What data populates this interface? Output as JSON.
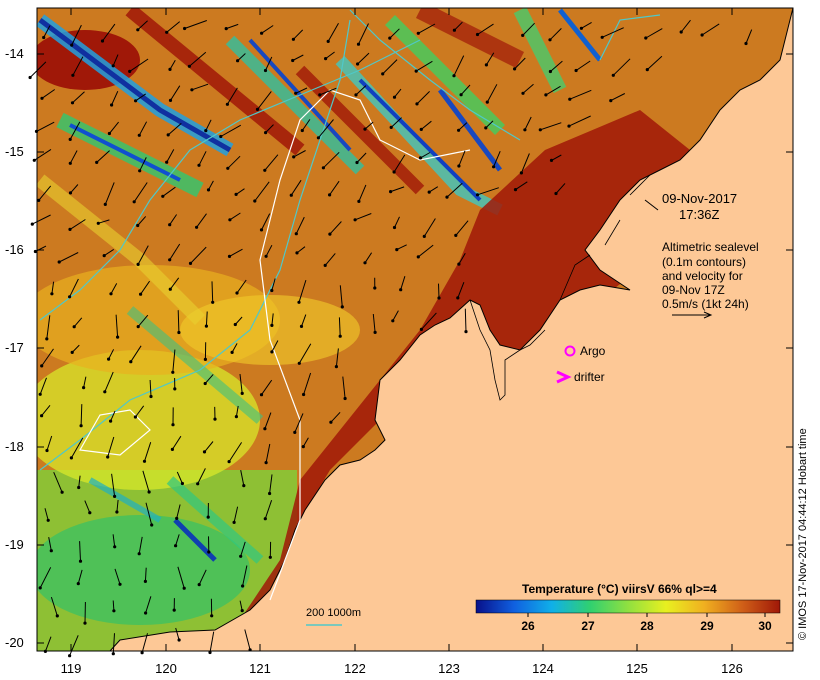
{
  "map": {
    "date": "09-Nov-2017",
    "time": "17:36Z",
    "note_lines": [
      "Altimetric sealevel",
      "(0.1m contours)",
      "and velocity for",
      "09-Nov 17Z",
      "0.5m/s (1kt 24h)"
    ],
    "legend": {
      "argo": "Argo",
      "drifter": "drifter"
    },
    "depth_label": "200  1000m",
    "colorbar": {
      "title": "Temperature (°C) viirsV 66% ql>=4",
      "ticks": [
        "26",
        "27",
        "28",
        "29",
        "30"
      ],
      "colors": [
        "#08108a",
        "#1060e0",
        "#10b0e8",
        "#30d070",
        "#90e040",
        "#e8f020",
        "#f0b020",
        "#d06018",
        "#a01808"
      ]
    },
    "lat_ticks": [
      "-14",
      "-15",
      "-16",
      "-17",
      "-18",
      "-19",
      "-20"
    ],
    "lon_ticks": [
      "119",
      "120",
      "121",
      "122",
      "123",
      "124",
      "125",
      "126"
    ],
    "credit": "© IMOS 17-Nov-2017 04:44:12 Hobart time",
    "colors": {
      "land": "#fdc896",
      "warm": "#c86418",
      "hot": "#a01808",
      "contour": "#50c8c8",
      "argo": "#ff00ff"
    }
  }
}
